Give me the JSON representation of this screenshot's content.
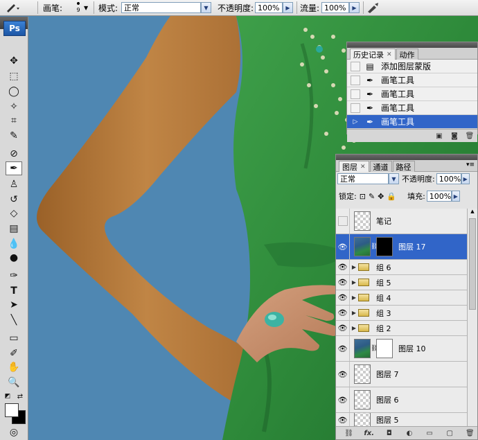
{
  "options_bar": {
    "brush_label": "画笔:",
    "brush_size": "9",
    "mode_label": "模式:",
    "mode_value": "正常",
    "opacity_label": "不透明度:",
    "opacity_value": "100%",
    "flow_label": "流量:",
    "flow_value": "100%"
  },
  "toolbox": {
    "logo": "Ps",
    "tools": [
      "move-tool",
      "marquee-tool",
      "lasso-tool",
      "magic-wand-tool",
      "crop-tool",
      "slice-tool",
      "healing-brush-tool",
      "brush-tool",
      "clone-stamp-tool",
      "history-brush-tool",
      "eraser-tool",
      "gradient-tool",
      "blur-tool",
      "dodge-tool",
      "pen-tool",
      "type-tool",
      "path-selection-tool",
      "line-tool",
      "notes-tool",
      "eyedropper-tool",
      "hand-tool",
      "zoom-tool"
    ]
  },
  "history_panel": {
    "tabs": [
      {
        "label": "历史记录",
        "active": true
      },
      {
        "label": "动作",
        "active": false
      }
    ],
    "items": [
      {
        "label": "添加图层蒙版",
        "icon": "document-icon",
        "selected": false
      },
      {
        "label": "画笔工具",
        "icon": "brush-icon",
        "selected": false
      },
      {
        "label": "画笔工具",
        "icon": "brush-icon",
        "selected": false
      },
      {
        "label": "画笔工具",
        "icon": "brush-icon",
        "selected": false
      },
      {
        "label": "画笔工具",
        "icon": "brush-icon",
        "selected": true
      }
    ]
  },
  "layers_panel": {
    "tabs": [
      {
        "label": "图层",
        "active": true
      },
      {
        "label": "通道",
        "active": false
      },
      {
        "label": "路径",
        "active": false
      }
    ],
    "blend_mode": "正常",
    "opacity_label": "不透明度:",
    "opacity_value": "100%",
    "lock_label": "锁定:",
    "fill_label": "填充:",
    "fill_value": "100%",
    "layers": [
      {
        "name": "笔记",
        "visible": false,
        "type": "layer",
        "selected": false
      },
      {
        "name": "图层 17",
        "visible": true,
        "type": "masked",
        "mask": "black",
        "selected": true
      },
      {
        "name": "组 6",
        "visible": true,
        "type": "group",
        "selected": false
      },
      {
        "name": "组 5",
        "visible": true,
        "type": "group",
        "selected": false
      },
      {
        "name": "组 4",
        "visible": true,
        "type": "group",
        "selected": false
      },
      {
        "name": "组 3",
        "visible": true,
        "type": "group",
        "selected": false
      },
      {
        "name": "组 2",
        "visible": true,
        "type": "group",
        "selected": false
      },
      {
        "name": "图层 10",
        "visible": true,
        "type": "masked",
        "mask": "white",
        "selected": false
      },
      {
        "name": "图层 7",
        "visible": true,
        "type": "layer",
        "selected": false
      },
      {
        "name": "图层 6",
        "visible": true,
        "type": "layer",
        "selected": false
      },
      {
        "name": "图层 5",
        "visible": true,
        "type": "layer",
        "selected": false
      }
    ],
    "footer_icons": [
      "link-icon",
      "fx-icon",
      "mask-icon",
      "adjustment-icon",
      "folder-icon",
      "new-layer-icon",
      "trash-icon"
    ]
  },
  "colors": {
    "background_blue": "#4f87b2",
    "dress_green": "#2f8d3c",
    "skin": "#b4793d",
    "selection": "#3165c8"
  }
}
